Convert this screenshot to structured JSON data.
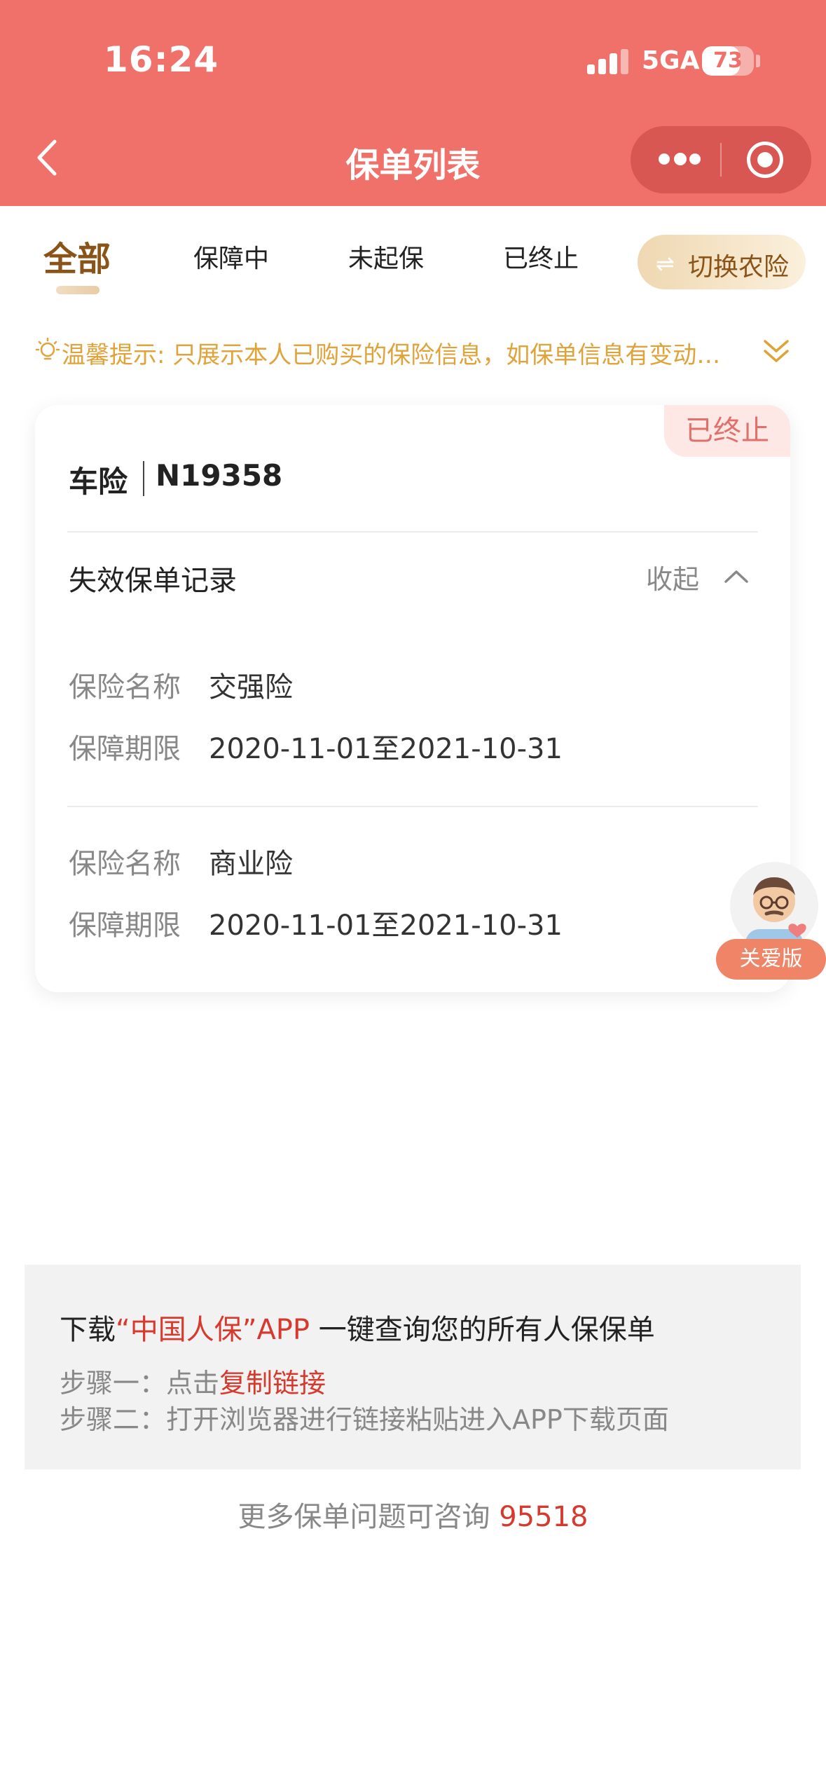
{
  "status_bar": {
    "time": "16:24",
    "network": "5GA",
    "battery": "73",
    "battery_level": 0.73
  },
  "header": {
    "title": "保单列表"
  },
  "tabs": [
    {
      "label": "全部",
      "active": true
    },
    {
      "label": "保障中",
      "active": false
    },
    {
      "label": "未起保",
      "active": false
    },
    {
      "label": "已终止",
      "active": false
    }
  ],
  "switch_button": {
    "label": "切换农险",
    "icon": "⇌"
  },
  "tip": {
    "text": "温馨提示: 只展示本人已购买的保险信息，如保单信息有变动…"
  },
  "policy_card": {
    "type": "车险",
    "plate": "N19358",
    "status": "已终止",
    "record_title": "失效保单记录",
    "collapse_label": "收起",
    "records": [
      {
        "name_label": "保险名称",
        "name": "交强险",
        "period_label": "保障期限",
        "period": "2020-11-01至2021-10-31"
      },
      {
        "name_label": "保险名称",
        "name": "商业险",
        "period_label": "保障期限",
        "period": "2020-11-01至2021-10-31"
      }
    ]
  },
  "care_button": {
    "label": "关爱版"
  },
  "download": {
    "prefix": "下载",
    "app_name": "“中国人保”APP",
    "suffix": " 一键查询您的所有人保保单",
    "step1_prefix": "步骤一：点击",
    "step1_link": "复制链接",
    "step2": "步骤二：打开浏览器进行链接粘贴进入APP下载页面"
  },
  "consult": {
    "text": "更多保单问题可咨询 ",
    "phone": "95518"
  },
  "colors": {
    "header": "#ef7169",
    "accent_brown": "#8a5419",
    "tip": "#e0a33a",
    "link_red": "#d63a2e"
  }
}
